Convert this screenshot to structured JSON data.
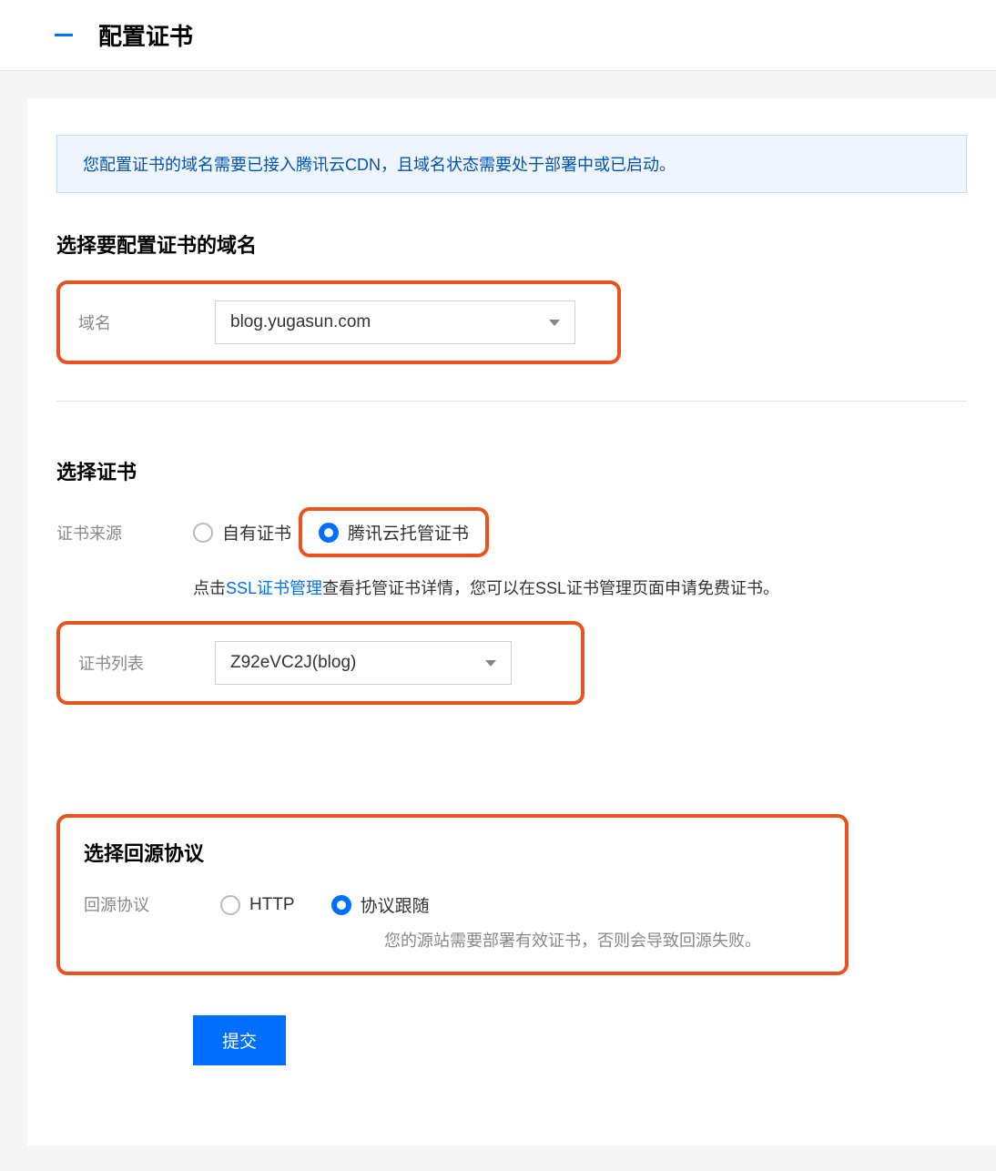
{
  "header": {
    "title": "配置证书"
  },
  "info": {
    "message": "您配置证书的域名需要已接入腾讯云CDN，且域名状态需要处于部署中或已启动。"
  },
  "section_domain": {
    "title": "选择要配置证书的域名",
    "label": "域名",
    "selected": "blog.yugasun.com"
  },
  "section_cert": {
    "title": "选择证书",
    "source_label": "证书来源",
    "options": {
      "own": "自有证书",
      "hosted": "腾讯云托管证书"
    },
    "hint_prefix": "点击",
    "hint_link": "SSL证书管理",
    "hint_suffix": "查看托管证书详情，您可以在SSL证书管理页面申请免费证书。",
    "list_label": "证书列表",
    "list_selected": "Z92eVC2J(blog)"
  },
  "section_protocol": {
    "title": "选择回源协议",
    "label": "回源协议",
    "options": {
      "http": "HTTP",
      "follow": "协议跟随"
    },
    "hint": "您的源站需要部署有效证书，否则会导致回源失败。"
  },
  "submit": {
    "label": "提交"
  }
}
